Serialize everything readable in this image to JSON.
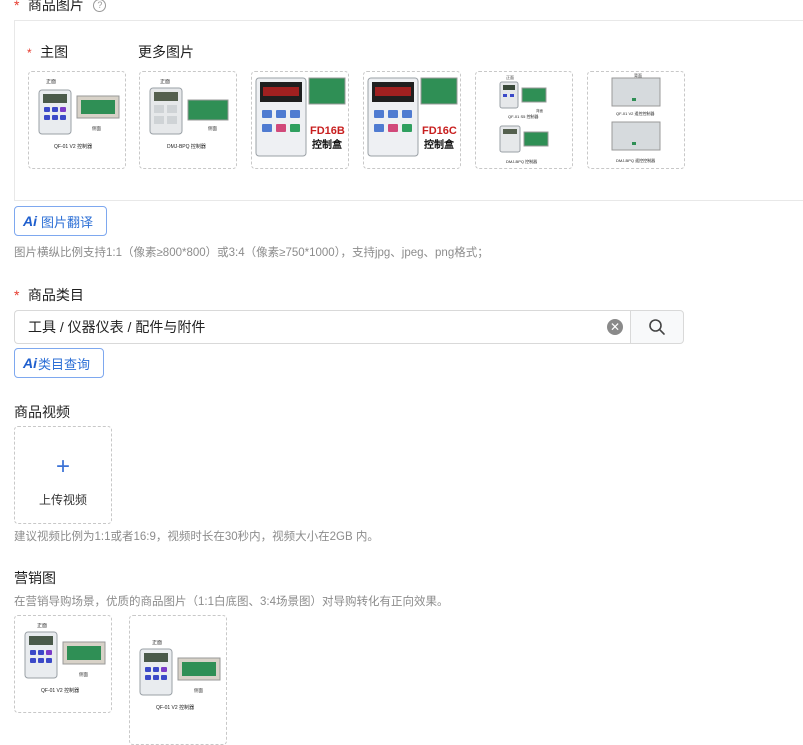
{
  "images_section": {
    "required_mark": "*",
    "label": "商品图片",
    "help_icon": "question-circle-icon",
    "main_label": "主图",
    "more_label": "更多图片",
    "thumbnails": [
      {
        "top_text": "正面",
        "side_text": "侧面",
        "caption": "QF-01 V2 控制器",
        "kind": "v2"
      },
      {
        "top_text": "正面",
        "side_text": "侧面",
        "caption": "DMJ-BPQ 控制器",
        "kind": "bpq"
      },
      {
        "badge": "FD16B",
        "badge_sub": "控制盒",
        "kind": "fd"
      },
      {
        "badge": "FD16C",
        "badge_sub": "控制盒",
        "kind": "fd"
      },
      {
        "top_caption": "QF-01 S5 控制器",
        "bottom_caption": "DMJ-BPQ 控制器",
        "top_text": "正面",
        "side_text": "背面",
        "kind": "double"
      },
      {
        "top_caption": "QF-01 V2 遥控控制器",
        "bottom_caption": "DMJ-BPQ 遥控控制器",
        "top_text": "背面",
        "side_text": "背面",
        "kind": "box"
      }
    ],
    "ai_button_label": "图片翻译",
    "ai_badge": "Ai",
    "hint": "图片横纵比例支持1:1（像素≥800*800）或3:4（像素≥750*1000），支持jpg、jpeg、png格式；"
  },
  "category_section": {
    "required_mark": "*",
    "label": "商品类目",
    "value": "工具 / 仪器仪表 / 配件与附件",
    "clear_icon": "clear-circle-icon",
    "search_icon": "search-icon",
    "ai_button_label": "类目查询",
    "ai_badge": "Ai"
  },
  "video_section": {
    "label": "商品视频",
    "upload_label": "上传视频",
    "upload_icon": "plus-icon",
    "hint": "建议视频比例为1:1或者16:9，视频时长在30秒内，视频大小在2GB 内。"
  },
  "marketing_section": {
    "label": "营销图",
    "hint": "在营销导购场景，优质的商品图片（1:1白底图、3:4场景图）对导购转化有正向效果。",
    "thumbnails": [
      {
        "top_text": "正面",
        "side_text": "侧面",
        "caption": "QF-01 V2 控制器"
      },
      {
        "top_text": "正面",
        "side_text": "侧面",
        "caption": "QF-01 V2 控制器"
      }
    ]
  },
  "colors": {
    "required": "#e63b2e",
    "ai_blue": "#2c6fd6",
    "hint_gray": "#8c8c8c"
  }
}
